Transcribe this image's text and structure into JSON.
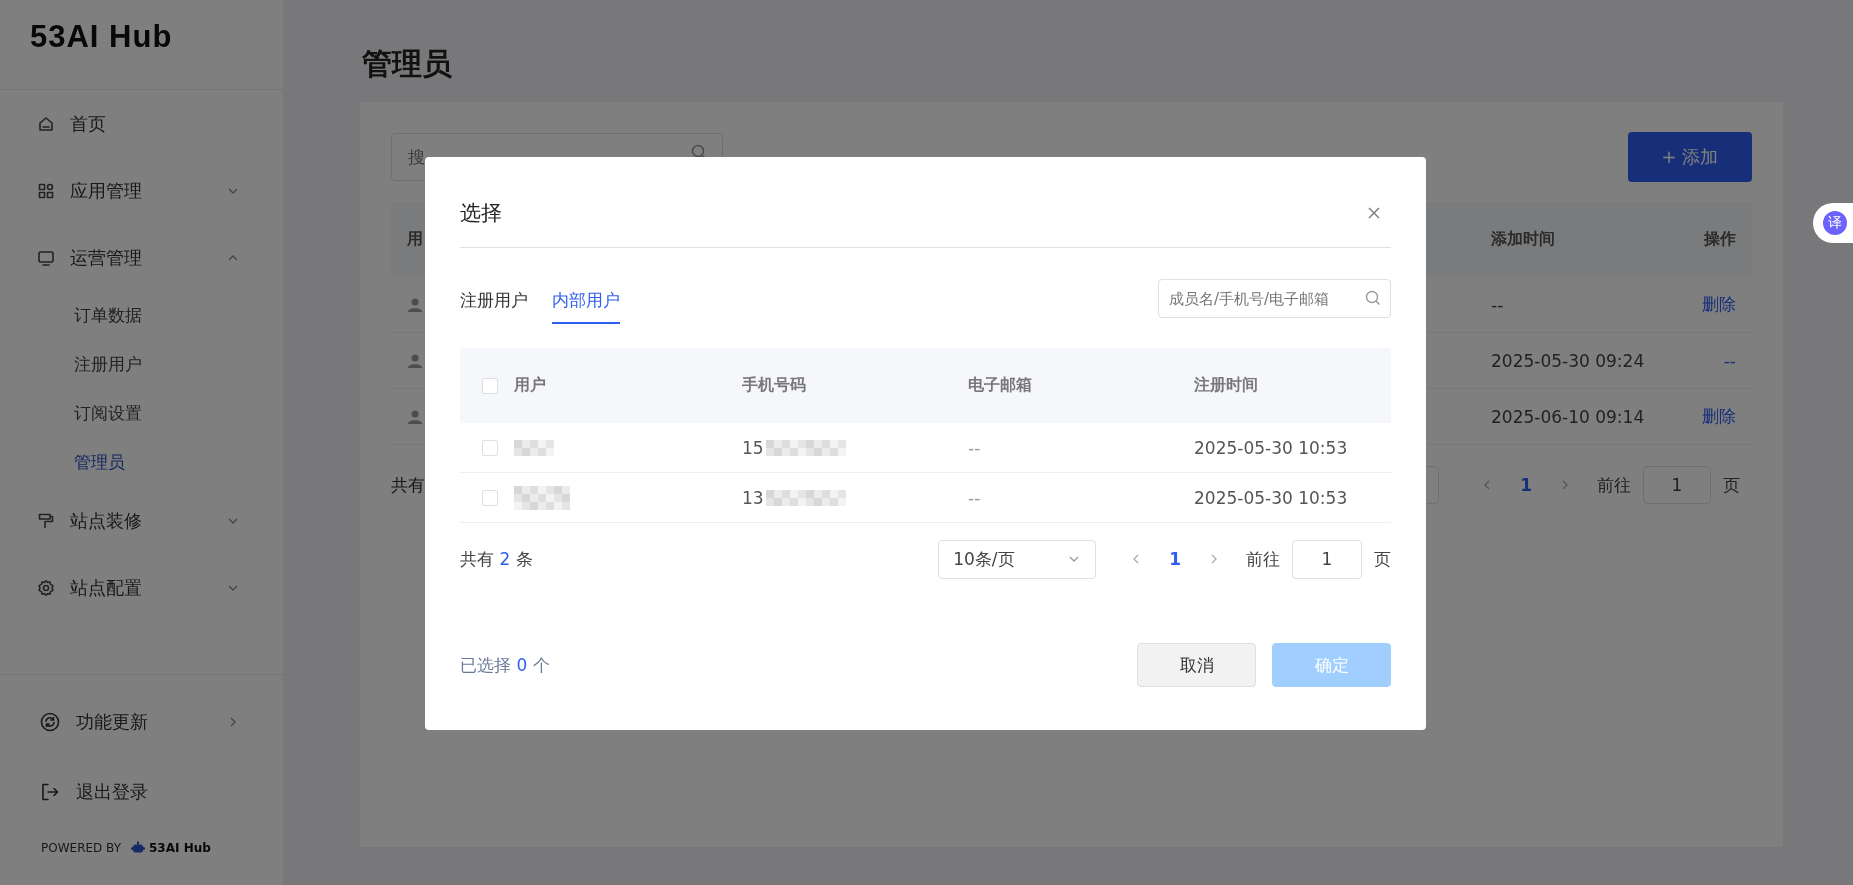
{
  "sidebar": {
    "logo": "53AI Hub",
    "nav": [
      {
        "label": "首页"
      },
      {
        "label": "应用管理",
        "expanded": false
      },
      {
        "label": "运营管理",
        "expanded": true,
        "children": [
          {
            "label": "订单数据",
            "selected": false
          },
          {
            "label": "注册用户",
            "selected": false
          },
          {
            "label": "订阅设置",
            "selected": false
          },
          {
            "label": "管理员",
            "selected": true
          }
        ]
      },
      {
        "label": "站点装修",
        "expanded": false
      },
      {
        "label": "站点配置",
        "expanded": false
      }
    ],
    "footer_items": [
      {
        "label": "功能更新"
      },
      {
        "label": "退出登录"
      }
    ],
    "powered_by": {
      "label": "POWERED BY",
      "brand": "53AI Hub"
    }
  },
  "page": {
    "title": "管理员",
    "search": {
      "placeholder": "搜"
    },
    "add_button": "+ 添加",
    "table": {
      "columns": [
        "用",
        "添加时间",
        "操作"
      ],
      "rows": [
        {
          "added": "--",
          "action": "删除"
        },
        {
          "added": "2025-05-30 09:24",
          "action": "--"
        },
        {
          "added": "2025-06-10 09:14",
          "action": "删除"
        }
      ]
    },
    "pagination": {
      "total": "共有",
      "current_page": "1",
      "goto_label": "前往",
      "goto_value": "1",
      "page_unit": "页"
    }
  },
  "translate_button": "译",
  "dialog": {
    "title": "选择",
    "tabs": [
      {
        "label": "注册用户",
        "selected": false
      },
      {
        "label": "内部用户",
        "selected": true
      }
    ],
    "search": {
      "placeholder": "成员名/手机号/电子邮箱"
    },
    "table": {
      "columns": [
        "用户",
        "手机号码",
        "电子邮箱",
        "注册时间"
      ],
      "header_checked": false,
      "rows": [
        {
          "checked": false,
          "phone": "15",
          "email": "--",
          "registered": "2025-05-30 10:53"
        },
        {
          "checked": false,
          "phone": "13",
          "email": "--",
          "registered": "2025-05-30 10:53"
        }
      ]
    },
    "pagination": {
      "total_prefix": "共有",
      "total": "2",
      "total_suffix": "条",
      "page_size": "10条/页",
      "current_page": "1",
      "goto_label": "前往",
      "goto_value": "1",
      "page_unit": "页"
    },
    "selected_count": {
      "prefix": "已选择",
      "count": "0",
      "suffix": "个"
    },
    "buttons": [
      {
        "label": "取消",
        "kind": "secondary",
        "disabled": false
      },
      {
        "label": "确定",
        "kind": "primary",
        "disabled": true
      }
    ]
  }
}
